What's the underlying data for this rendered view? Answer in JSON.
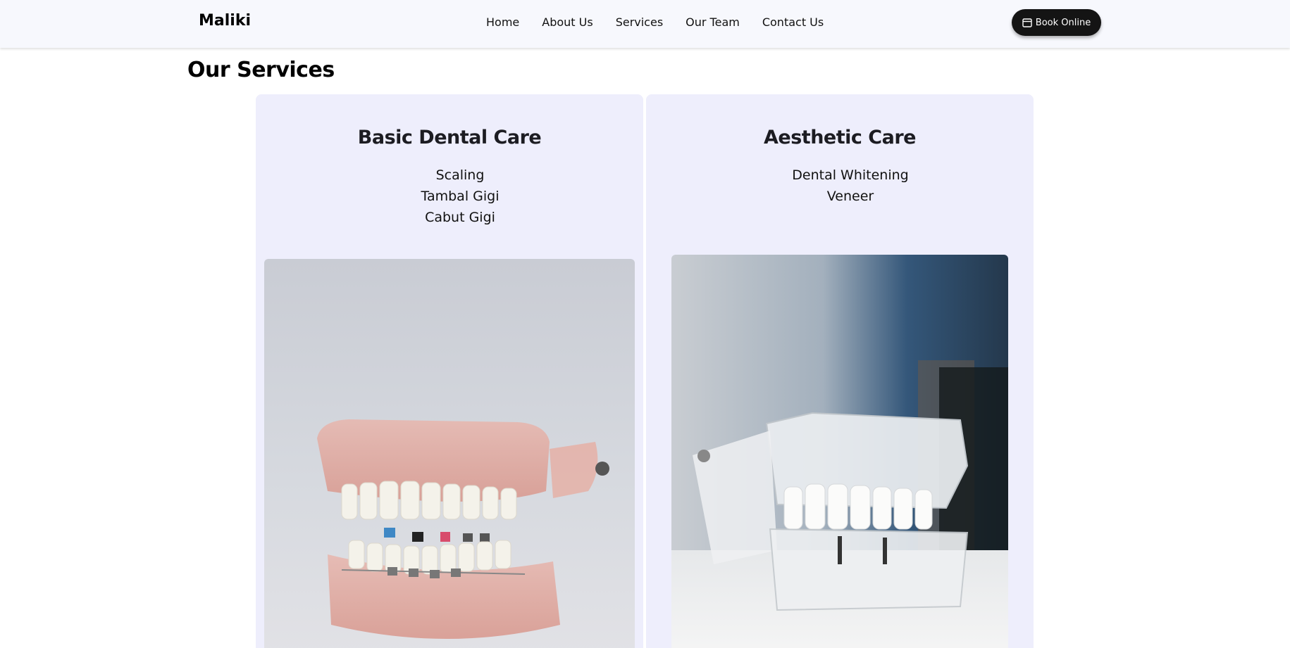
{
  "brand": "Maliki",
  "nav": {
    "links": [
      "Home",
      "About Us",
      "Services",
      "Our Team",
      "Contact Us"
    ],
    "book_label": "Book Online"
  },
  "services": {
    "title": "Our Services",
    "cards": [
      {
        "title": "Basic Dental Care",
        "items": [
          "Scaling",
          "Tambal Gigi",
          "Cabut Gigi"
        ],
        "image": "dental-model-braces-photo"
      },
      {
        "title": "Aesthetic Care",
        "items": [
          "Dental Whitening",
          "Veneer"
        ],
        "image": "dental-model-implant-photo"
      }
    ]
  },
  "colors": {
    "nav_bg": "#f7f8fd",
    "card_bg": "#eeeefc",
    "button_bg": "#141414"
  }
}
